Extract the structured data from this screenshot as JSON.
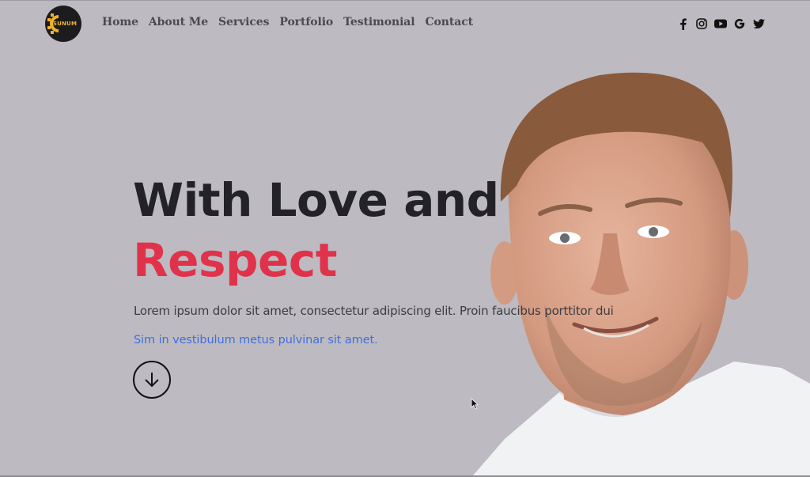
{
  "header": {
    "logo_text": "SUNUM",
    "nav": [
      {
        "label": "Home"
      },
      {
        "label": "About Me"
      },
      {
        "label": "Services"
      },
      {
        "label": "Portfolio"
      },
      {
        "label": "Testimonial"
      },
      {
        "label": "Contact"
      }
    ],
    "socials": [
      "facebook-icon",
      "instagram-icon",
      "youtube-icon",
      "google-icon",
      "twitter-icon"
    ]
  },
  "hero": {
    "title_line1": "With Love and",
    "title_line2": "Respect",
    "lead": "Lorem ipsum dolor sit amet, consectetur adipiscing elit. Proin faucibus porttitor dui",
    "link_text": "Sim in vestibulum metus pulvinar sit amet.",
    "scroll_icon": "arrow-down-circle-icon"
  },
  "colors": {
    "background": "#bdbbc1",
    "title": "#232327",
    "accent": "#e0334b",
    "link": "#3f6fe0",
    "logo_gold": "#f1b22a"
  }
}
